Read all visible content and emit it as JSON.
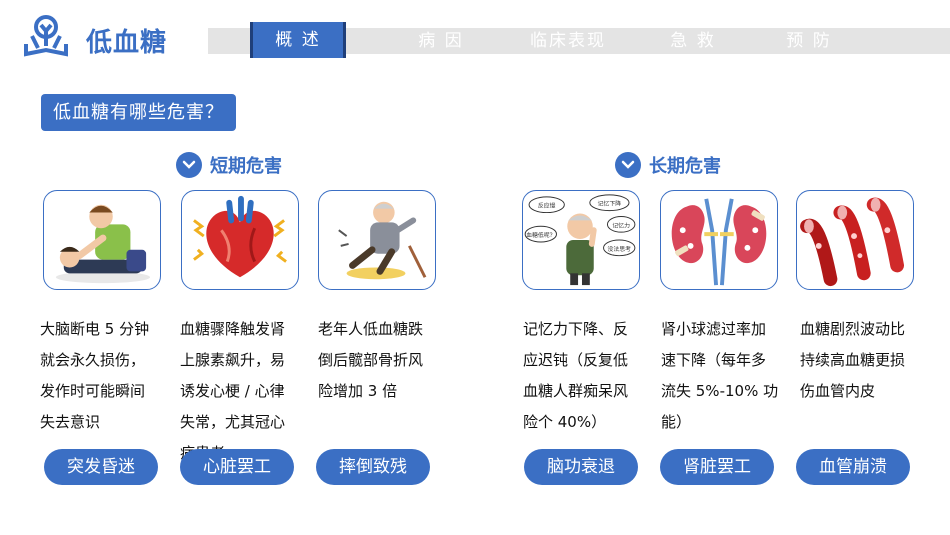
{
  "header": {
    "app_title": "低血糖",
    "logo_icon": "person-book-logo-icon",
    "accent": "#3b6fc4"
  },
  "nav": {
    "tabs": [
      {
        "label": "概 述",
        "active": true
      },
      {
        "label": "病 因",
        "active": false
      },
      {
        "label": "临床表现",
        "active": false
      },
      {
        "label": "急 救",
        "active": false
      },
      {
        "label": "预 防",
        "active": false
      }
    ]
  },
  "question": "低血糖有哪些危害？",
  "short_term": {
    "label": "短期危害",
    "items": [
      {
        "desc": "大脑断电 5 分钟就会永久损伤，发作时可能瞬间失去意识",
        "tag": "突发昏迷",
        "icon": "cpr-rescue-icon"
      },
      {
        "desc": "血糖骤降触发肾上腺素飙升，易诱发心梗 / 心律失常，尤其冠心病患者",
        "tag": "心脏罢工",
        "icon": "heart-icon"
      },
      {
        "desc": "老年人低血糖跌倒后髋部骨折风险增加 3 倍",
        "tag": "摔倒致残",
        "icon": "elderly-fall-icon"
      }
    ]
  },
  "long_term": {
    "label": "长期危害",
    "items": [
      {
        "desc": "记忆力下降、反应迟钝（反复低血糖人群痴呆风险个 40%）",
        "tag": "脑功衰退",
        "icon": "confused-elder-icon",
        "bubbles": [
          "反应慢",
          "记忆下降",
          "血糖低呢？",
          "记忆力",
          "没法思考"
        ]
      },
      {
        "desc": "肾小球滤过率加速下降（每年多流失 5%-10% 功能）",
        "tag": "肾脏罢工",
        "icon": "kidney-icon"
      },
      {
        "desc": "血糖剧烈波动比持续高血糖更损伤血管内皮",
        "tag": "血管崩溃",
        "icon": "blood-vessel-icon"
      }
    ]
  }
}
